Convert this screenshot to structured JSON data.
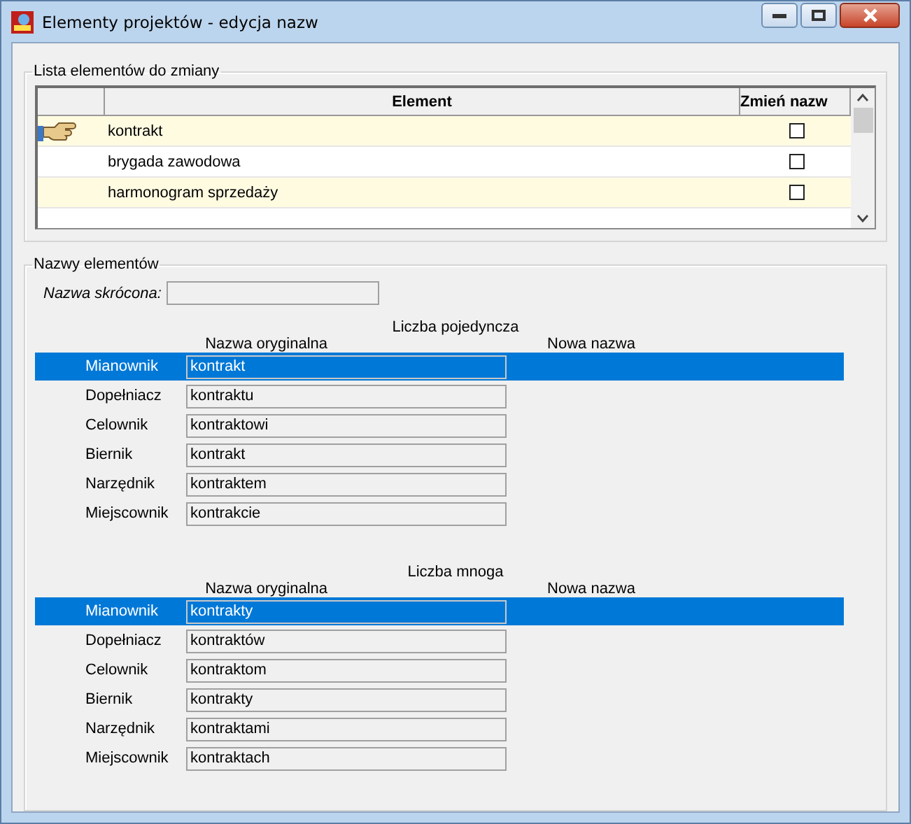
{
  "window": {
    "title": "Elementy projektów - edycja nazw"
  },
  "list_group": {
    "legend": "Lista elementów do zmiany",
    "columns": [
      "Element",
      "Zmień nazw"
    ],
    "rows": [
      {
        "element": "kontrakt",
        "checked": false,
        "current": true
      },
      {
        "element": "brygada zawodowa",
        "checked": false,
        "current": false
      },
      {
        "element": "harmonogram sprzedaży",
        "checked": false,
        "current": false
      }
    ]
  },
  "names_group": {
    "legend": "Nazwy elementów",
    "short_name_label": "Nazwa skrócona:",
    "sections": [
      {
        "title": "Liczba pojedyncza",
        "col_original": "Nazwa oryginalna",
        "col_new": "Nowa nazwa",
        "rows": [
          {
            "case": "Mianownik",
            "original": "kontrakt",
            "selected": true
          },
          {
            "case": "Dopełniacz",
            "original": "kontraktu",
            "selected": false
          },
          {
            "case": "Celownik",
            "original": "kontraktowi",
            "selected": false
          },
          {
            "case": "Biernik",
            "original": "kontrakt",
            "selected": false
          },
          {
            "case": "Narzędnik",
            "original": "kontraktem",
            "selected": false
          },
          {
            "case": "Miejscownik",
            "original": "kontrakcie",
            "selected": false
          }
        ]
      },
      {
        "title": "Liczba mnoga",
        "col_original": "Nazwa oryginalna",
        "col_new": "Nowa nazwa",
        "rows": [
          {
            "case": "Mianownik",
            "original": "kontrakty",
            "selected": true
          },
          {
            "case": "Dopełniacz",
            "original": "kontraktów",
            "selected": false
          },
          {
            "case": "Celownik",
            "original": "kontraktom",
            "selected": false
          },
          {
            "case": "Biernik",
            "original": "kontrakty",
            "selected": false
          },
          {
            "case": "Narzędnik",
            "original": "kontraktami",
            "selected": false
          },
          {
            "case": "Miejscownik",
            "original": "kontraktach",
            "selected": false
          }
        ]
      }
    ]
  }
}
